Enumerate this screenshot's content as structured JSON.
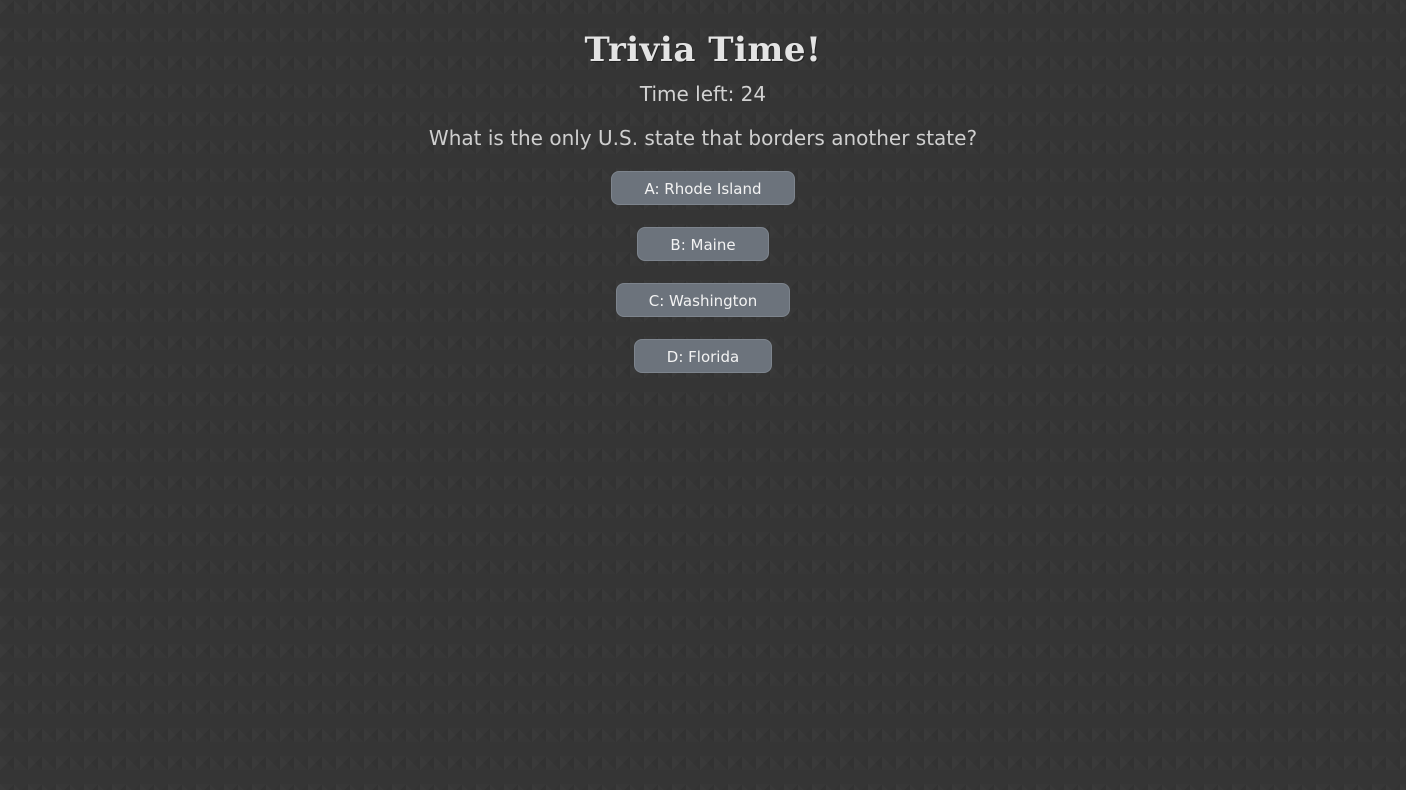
{
  "header": {
    "title": "Trivia Time!",
    "timer_text": "Time left: 24"
  },
  "question": {
    "text": "What is the only U.S. state that borders another state?"
  },
  "answers": [
    {
      "label": "A: Rhode Island"
    },
    {
      "label": "B: Maine"
    },
    {
      "label": "C: Washington"
    },
    {
      "label": "D: Florida"
    }
  ],
  "colors": {
    "background": "#353535",
    "button": "#6c737c",
    "text": "#d6d6d6"
  }
}
